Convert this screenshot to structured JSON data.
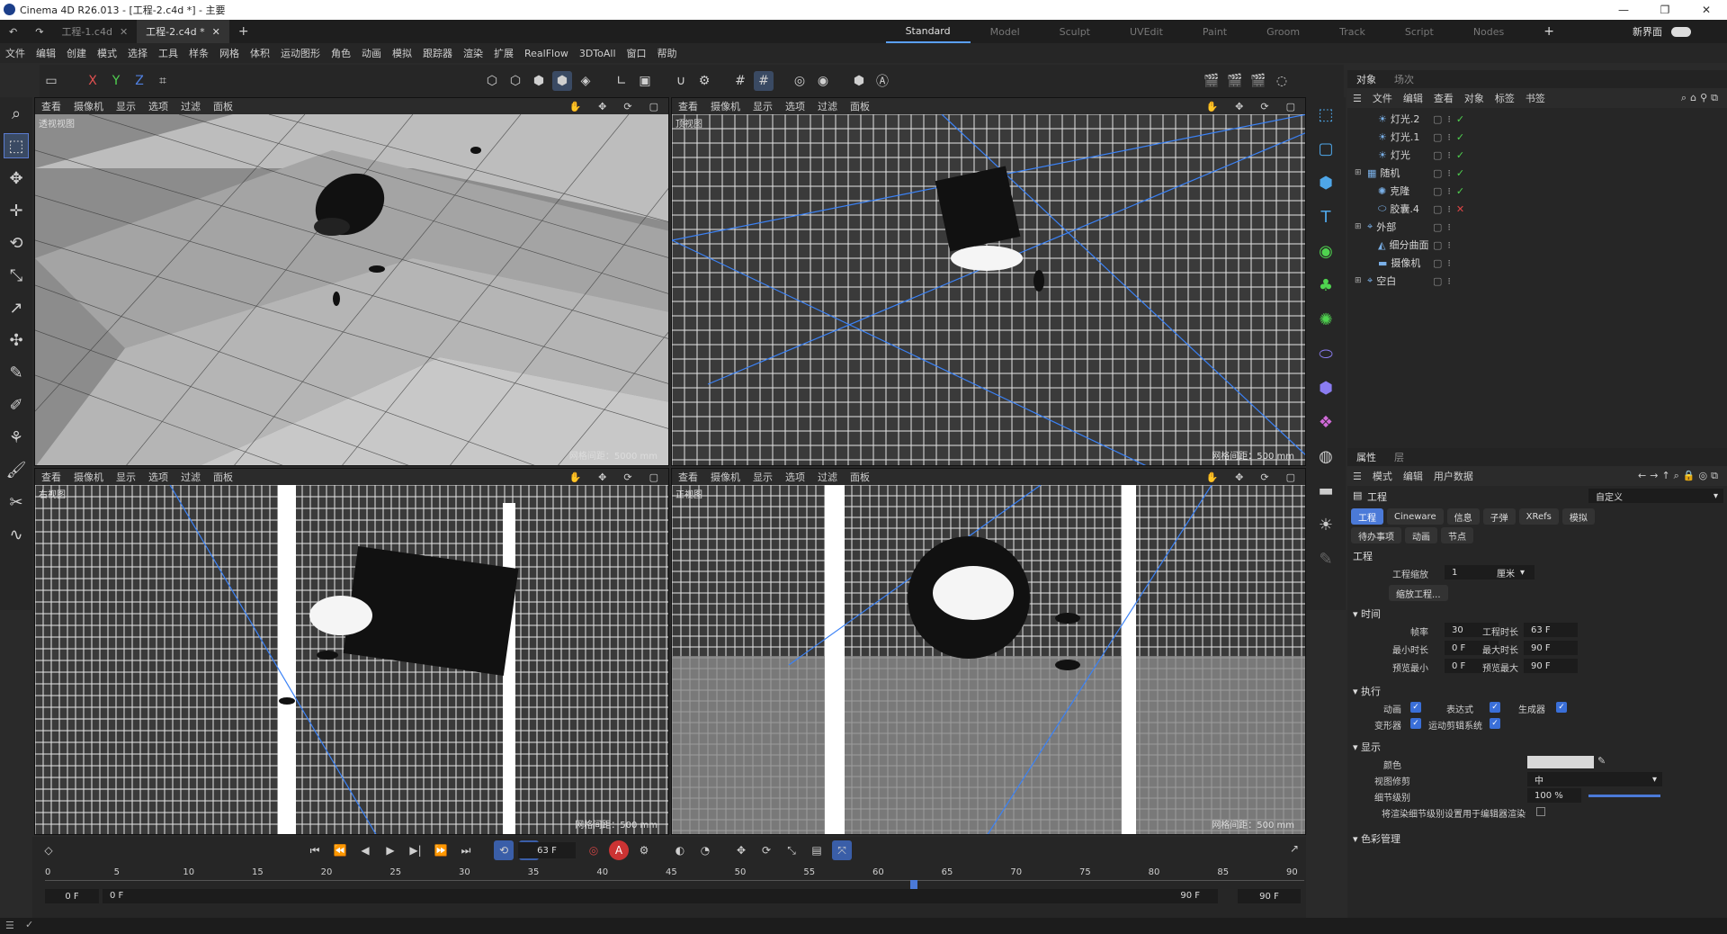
{
  "app": {
    "title": "Cinema 4D R26.013 - [工程-2.c4d *] - 主要"
  },
  "window_controls": [
    "—",
    "❐",
    "✕"
  ],
  "doc_tabs": [
    {
      "label": "工程-1.c4d",
      "active": false
    },
    {
      "label": "工程-2.c4d *",
      "active": true
    }
  ],
  "layouts": [
    {
      "label": "Standard",
      "active": true
    },
    {
      "label": "Model"
    },
    {
      "label": "Sculpt"
    },
    {
      "label": "UVEdit"
    },
    {
      "label": "Paint"
    },
    {
      "label": "Groom"
    },
    {
      "label": "Track"
    },
    {
      "label": "Script"
    },
    {
      "label": "Nodes"
    }
  ],
  "new_ui_label": "新界面",
  "menu": [
    "文件",
    "编辑",
    "创建",
    "模式",
    "选择",
    "工具",
    "样条",
    "网格",
    "体积",
    "运动图形",
    "角色",
    "动画",
    "模拟",
    "跟踪器",
    "渲染",
    "扩展",
    "RealFlow",
    "3DToAll",
    "窗口",
    "帮助"
  ],
  "axis_buttons": [
    "X",
    "Y",
    "Z"
  ],
  "viewport_menu": [
    "查看",
    "摄像机",
    "显示",
    "选项",
    "过滤",
    "面板"
  ],
  "viewports": [
    {
      "label": "透视视图",
      "grid": "网格间距：5000 mm",
      "kind": "persp"
    },
    {
      "label": "顶视图",
      "grid": "网格间距：500 mm",
      "kind": "top"
    },
    {
      "label": "右视图",
      "grid": "网格间距：500 mm",
      "kind": "right"
    },
    {
      "label": "正视图",
      "grid": "网格间距：500 mm",
      "kind": "front"
    }
  ],
  "objects_panel": {
    "tabs": [
      "对象",
      "场次"
    ],
    "menu": [
      "文件",
      "编辑",
      "查看",
      "对象",
      "标签",
      "书签"
    ],
    "rows": [
      {
        "name": "灯光.2",
        "icon": "light",
        "indent": 1,
        "status": "check"
      },
      {
        "name": "灯光.1",
        "icon": "light",
        "indent": 1,
        "status": "check"
      },
      {
        "name": "灯光",
        "icon": "light",
        "indent": 1,
        "status": "check"
      },
      {
        "name": "随机",
        "icon": "random",
        "indent": 0,
        "status": "check"
      },
      {
        "name": "克隆",
        "icon": "cloner",
        "indent": 1,
        "status": "check"
      },
      {
        "name": "胶囊.4",
        "icon": "capsule",
        "indent": 1,
        "status": "x"
      },
      {
        "name": "外部",
        "icon": "null",
        "indent": 0,
        "status": ""
      },
      {
        "name": "细分曲面",
        "icon": "subdiv",
        "indent": 1,
        "status": ""
      },
      {
        "name": "摄像机",
        "icon": "camera",
        "indent": 1,
        "status": ""
      },
      {
        "name": "空白",
        "icon": "null",
        "indent": 0,
        "status": ""
      }
    ]
  },
  "attributes_panel": {
    "tabs": [
      "属性",
      "层"
    ],
    "menu": [
      "模式",
      "编辑",
      "用户数据"
    ],
    "header": "工程",
    "preset": "自定义",
    "sub_tabs_1": [
      {
        "label": "工程",
        "active": true
      },
      {
        "label": "Cineware"
      },
      {
        "label": "信息"
      },
      {
        "label": "子弹"
      },
      {
        "label": "XRefs"
      },
      {
        "label": "模拟"
      }
    ],
    "sub_tabs_2": [
      {
        "label": "待办事项"
      },
      {
        "label": "动画"
      },
      {
        "label": "节点"
      }
    ],
    "section_project": "工程",
    "scale_label": "工程缩放",
    "scale_value": "1",
    "scale_unit": "厘米",
    "scale_button": "缩放工程...",
    "time_section": "时间",
    "time": {
      "fps_label": "帧率",
      "fps": "30",
      "duration_label": "工程时长",
      "duration": "63 F",
      "min_label": "最小时长",
      "min": "0 F",
      "max_label": "最大时长",
      "max": "90 F",
      "pmin_label": "预览最小",
      "pmin": "0 F",
      "pmax_label": "预览最大",
      "pmax": "90 F"
    },
    "exec_section": "执行",
    "exec": [
      {
        "label": "动画",
        "checked": true
      },
      {
        "label": "表达式",
        "checked": true
      },
      {
        "label": "生成器",
        "checked": true
      },
      {
        "label": "变形器",
        "checked": true
      },
      {
        "label": "运动剪辑系统",
        "checked": true
      }
    ],
    "display_section": "显示",
    "display": {
      "color_label": "颜色",
      "clip_label": "视图修剪",
      "clip_value": "中",
      "lod_label": "细节级别",
      "lod_value": "100 %",
      "render_lod_label": "将渲染细节级别设置用于编辑器渲染"
    },
    "color_section": "色彩管理"
  },
  "timeline": {
    "current_frame": "63 F",
    "current_frame_value": 63,
    "ticks": [
      "0",
      "5",
      "10",
      "15",
      "20",
      "25",
      "30",
      "35",
      "40",
      "45",
      "50",
      "55",
      "60",
      "65",
      "70",
      "75",
      "80",
      "85",
      "90"
    ],
    "start": "0 F",
    "start2": "0 F",
    "end": "90 F",
    "end2": "90 F"
  },
  "colors": {
    "accent": "#4b7ad8",
    "check": "#4fd34f",
    "x": "#e04545",
    "viewport_bg": "#1a1a1a"
  }
}
